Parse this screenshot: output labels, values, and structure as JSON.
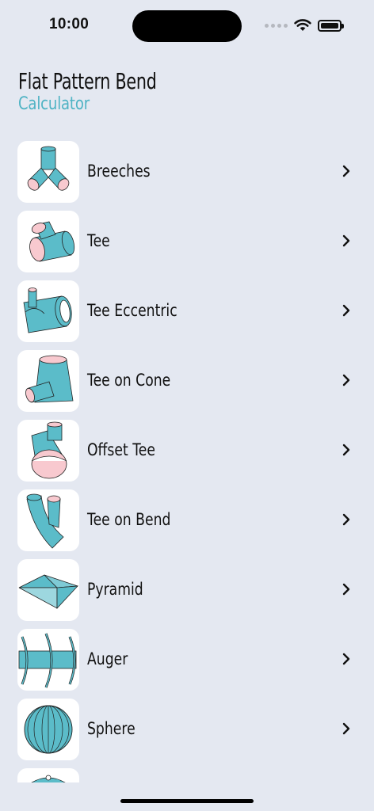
{
  "status": {
    "time": "10:00"
  },
  "header": {
    "title": "Flat Pattern Bend",
    "subtitle": "Calculator"
  },
  "colors": {
    "accent": "#4fb3c4",
    "shape": "#5bbcc9",
    "cut": "#f8c9cf",
    "background": "#e4e8f1"
  },
  "items": [
    {
      "label": "Breeches",
      "icon": "breeches-icon"
    },
    {
      "label": "Tee",
      "icon": "tee-icon"
    },
    {
      "label": "Tee Eccentric",
      "icon": "tee-eccentric-icon"
    },
    {
      "label": "Tee on Cone",
      "icon": "tee-on-cone-icon"
    },
    {
      "label": "Offset Tee",
      "icon": "offset-tee-icon"
    },
    {
      "label": "Tee on Bend",
      "icon": "tee-on-bend-icon"
    },
    {
      "label": "Pyramid",
      "icon": "pyramid-icon"
    },
    {
      "label": "Auger",
      "icon": "auger-icon"
    },
    {
      "label": "Sphere",
      "icon": "sphere-icon"
    },
    {
      "label": "",
      "icon": "partial-item-icon"
    }
  ]
}
